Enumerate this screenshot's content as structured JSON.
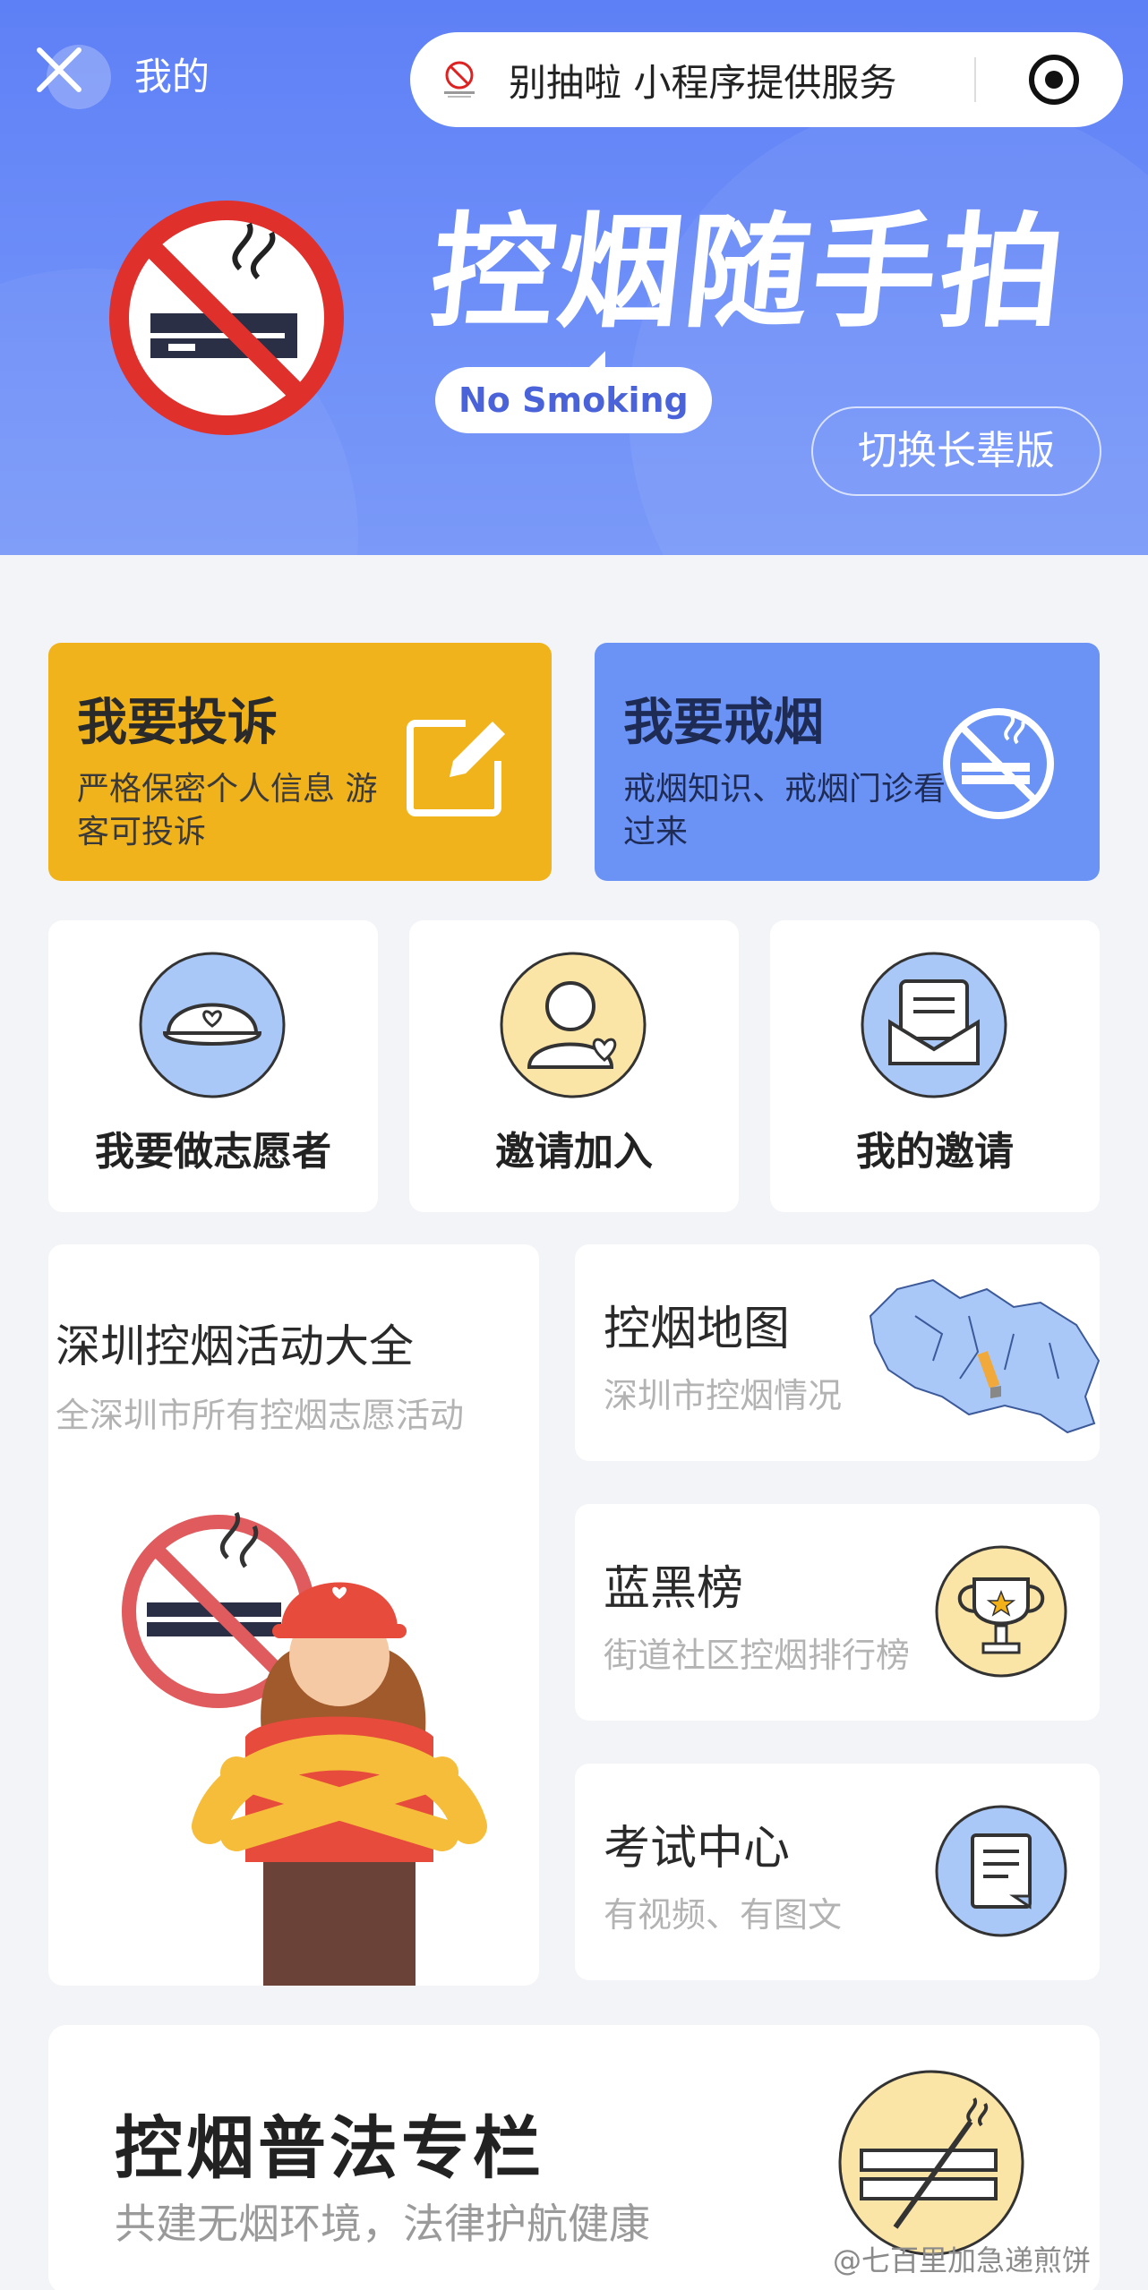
{
  "header": {
    "me_label": "我的",
    "capsule_title": "别抽啦 小程序提供服务",
    "hero_title": "控烟随手拍",
    "hero_tag": "No Smoking",
    "switch_label": "切换长辈版"
  },
  "actions": {
    "complain": {
      "title": "我要投诉",
      "subtitle": "严格保密个人信息 游客可投诉"
    },
    "quit": {
      "title": "我要戒烟",
      "subtitle": "戒烟知识、戒烟门诊看过来"
    }
  },
  "tiles": [
    {
      "label": "我要做志愿者"
    },
    {
      "label": "邀请加入"
    },
    {
      "label": "我的邀请"
    }
  ],
  "activities": {
    "title": "深圳控烟活动大全",
    "subtitle": "全深圳市所有控烟志愿活动"
  },
  "map": {
    "title": "控烟地图",
    "subtitle": "深圳市控烟情况"
  },
  "rank": {
    "title": "蓝黑榜",
    "subtitle": "街道社区控烟排行榜"
  },
  "exam": {
    "title": "考试中心",
    "subtitle": "有视频、有图文"
  },
  "law": {
    "title": "控烟普法专栏",
    "subtitle": "共建无烟环境，法律护航健康"
  },
  "watermark": "@七百里加急递煎饼",
  "colors": {
    "header_blue": "#5e80f6",
    "complain_yellow": "#f0b31c",
    "quit_blue": "#6b93f5",
    "icon_circle_blue": "#a9c8f7",
    "icon_circle_yellow": "#fbe5a6"
  }
}
